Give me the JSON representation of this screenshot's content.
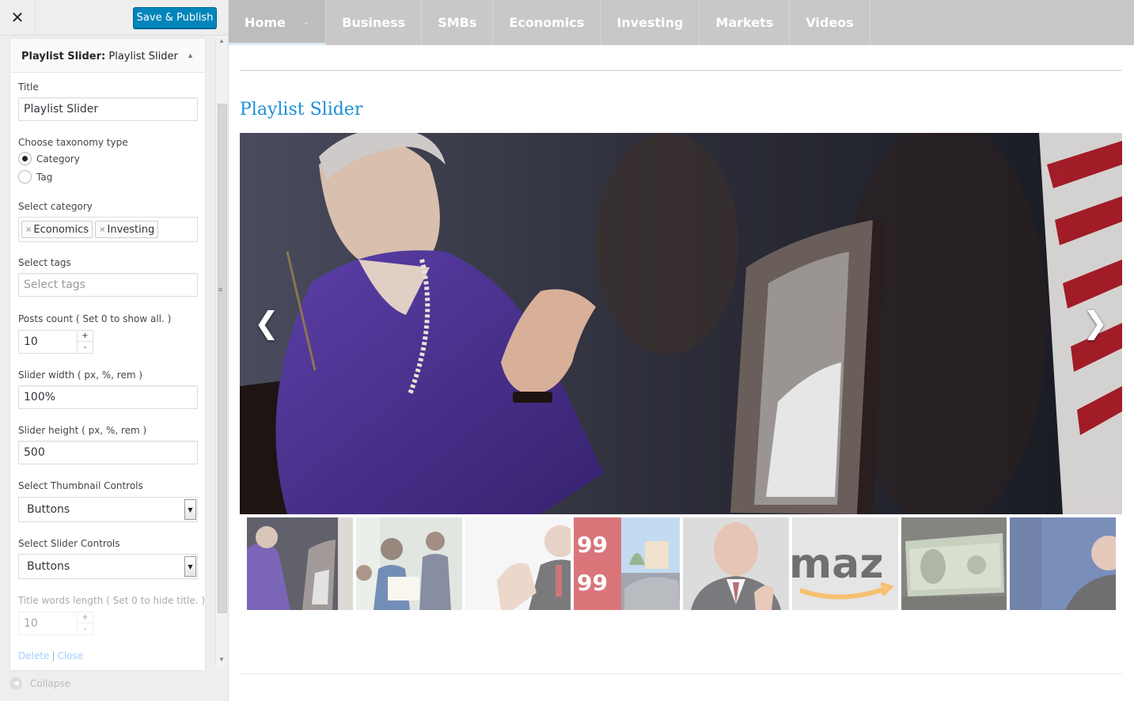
{
  "sidebar": {
    "close_icon": "close-icon",
    "publish_label": "Save & Publish",
    "widget": {
      "title_prefix": "Playlist Slider:",
      "title_name": "Playlist Slider",
      "fields": {
        "title_label": "Title",
        "title_value": "Playlist Slider",
        "taxonomy_label": "Choose taxonomy type",
        "taxonomy_options": [
          "Category",
          "Tag"
        ],
        "taxonomy_selected": "Category",
        "category_label": "Select category",
        "categories": [
          "Economics",
          "Investing"
        ],
        "tags_label": "Select tags",
        "tags_placeholder": "Select tags",
        "posts_count_label": "Posts count ( Set 0 to show all. )",
        "posts_count_value": "10",
        "slider_width_label": "Slider width ( px, %, rem )",
        "slider_width_value": "100%",
        "slider_height_label": "Slider height ( px, %, rem )",
        "slider_height_value": "500",
        "thumb_controls_label": "Select Thumbnail Controls",
        "thumb_controls_value": "Buttons",
        "slider_controls_label": "Select Slider Controls",
        "slider_controls_value": "Buttons",
        "title_words_label": "Title words length ( Set 0 to hide title. )",
        "title_words_value": "10"
      },
      "delete_label": "Delete",
      "close_label": "Close"
    },
    "collapse_label": "Collapse"
  },
  "preview": {
    "nav": [
      "Home",
      "Business",
      "SMBs",
      "Economics",
      "Investing",
      "Markets",
      "Videos"
    ],
    "nav_active": "Home",
    "slider_title": "Playlist Slider",
    "prev_arrow": "❮",
    "next_arrow": "❯",
    "thumbnails": [
      "yellen",
      "team-photo",
      "man-gesturing",
      "gas-prices",
      "man-suit",
      "amazon-logo",
      "dollar-bills",
      "speaker-blue"
    ],
    "text_in_images": {
      "amazon": "maz",
      "gas_price": "99"
    }
  },
  "colors": {
    "accent": "#0085ba",
    "title_blue": "#1a8fd6",
    "nav_bg": "#c8c8c8"
  }
}
